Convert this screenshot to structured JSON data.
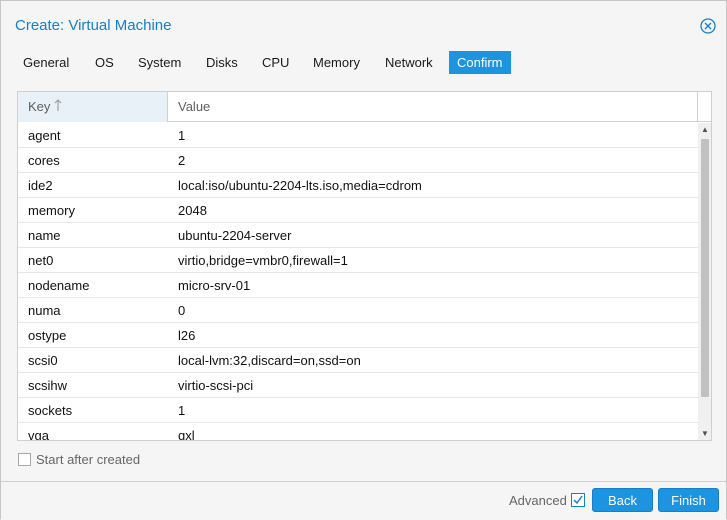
{
  "window": {
    "title": "Create: Virtual Machine"
  },
  "tabs": [
    {
      "label": "General",
      "active": false
    },
    {
      "label": "OS",
      "active": false
    },
    {
      "label": "System",
      "active": false
    },
    {
      "label": "Disks",
      "active": false
    },
    {
      "label": "CPU",
      "active": false
    },
    {
      "label": "Memory",
      "active": false
    },
    {
      "label": "Network",
      "active": false
    },
    {
      "label": "Confirm",
      "active": true
    }
  ],
  "grid": {
    "columns": {
      "key": "Key",
      "value": "Value"
    },
    "sort": {
      "column": "key",
      "direction": "ascending"
    },
    "rows": [
      {
        "key": "agent",
        "value": "1"
      },
      {
        "key": "cores",
        "value": "2"
      },
      {
        "key": "ide2",
        "value": "local:iso/ubuntu-2204-lts.iso,media=cdrom"
      },
      {
        "key": "memory",
        "value": "2048"
      },
      {
        "key": "name",
        "value": "ubuntu-2204-server"
      },
      {
        "key": "net0",
        "value": "virtio,bridge=vmbr0,firewall=1"
      },
      {
        "key": "nodename",
        "value": "micro-srv-01"
      },
      {
        "key": "numa",
        "value": "0"
      },
      {
        "key": "ostype",
        "value": "l26"
      },
      {
        "key": "scsi0",
        "value": "local-lvm:32,discard=on,ssd=on"
      },
      {
        "key": "scsihw",
        "value": "virtio-scsi-pci"
      },
      {
        "key": "sockets",
        "value": "1"
      },
      {
        "key": "vga",
        "value": "qxl"
      }
    ]
  },
  "options": {
    "start_after_created": {
      "label": "Start after created",
      "checked": false
    }
  },
  "footer": {
    "advanced": {
      "label": "Advanced",
      "checked": true
    },
    "back_label": "Back",
    "finish_label": "Finish"
  },
  "colors": {
    "accent": "#1c94e0",
    "title": "#157fcc"
  },
  "icons": {
    "close": "close-circle-icon",
    "sort": "sort-ascending-arrow",
    "check": "checkmark-icon"
  }
}
